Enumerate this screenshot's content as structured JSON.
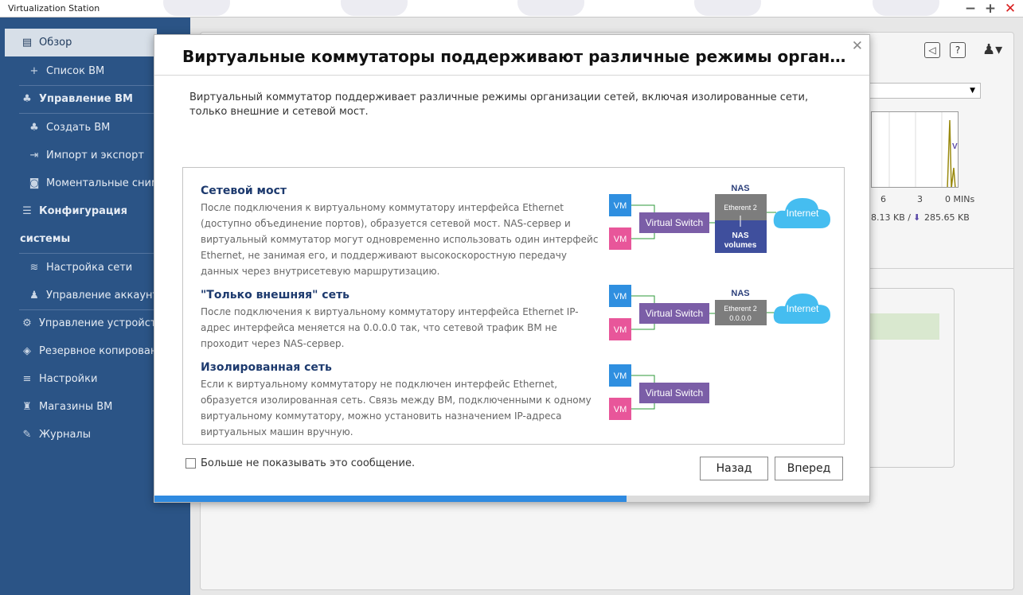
{
  "window": {
    "title": "Virtualization Station"
  },
  "sidebar": {
    "items": [
      {
        "label": "Обзор"
      },
      {
        "label": "Список ВМ"
      },
      {
        "label": "Управление ВМ"
      },
      {
        "label": "Создать ВМ"
      },
      {
        "label": "Импорт и экспорт"
      },
      {
        "label": "Моментальные сним..."
      },
      {
        "label": "Конфигурация"
      },
      {
        "label": "системы"
      },
      {
        "label": "Настройка сети"
      },
      {
        "label": "Управление аккаунт..."
      },
      {
        "label": "Управление устройств..."
      },
      {
        "label": "Резервное копирован..."
      },
      {
        "label": "Настройки"
      },
      {
        "label": "Магазины ВМ"
      },
      {
        "label": "Журналы"
      }
    ]
  },
  "main": {
    "ticks": [
      "6",
      "3",
      "0 MINs"
    ],
    "rate_up": "8.13 KB /",
    "rate_down": "285.65 KB",
    "chart_label": "V"
  },
  "modal": {
    "title": "Виртуальные коммутаторы поддерживают различные режимы организации сетей",
    "intro": "Виртуальный коммутатор поддерживает различные режимы организации сетей, включая изолированные сети, только внешние и сетевой мост.",
    "sections": [
      {
        "title": "Сетевой мост",
        "desc": "После подключения к виртуальному коммутатору интерфейса Ethernet (доступно объединение портов), образуется сетевой мост. NAS-сервер и виртуальный коммутатор могут одновременно использовать один интерфейс Ethernet, не занимая его, и поддерживают высокоскоростную передачу данных через внутрисетевую маршрутизацию."
      },
      {
        "title": "\"Только внешняя\" сеть",
        "desc": "После подключения к виртуальному коммутатору интерфейса Ethernet IP-адрес интерфейса меняется на 0.0.0.0 так, что сетевой трафик ВМ не проходит через NAS-сервер."
      },
      {
        "title": "Изолированная сеть",
        "desc": "Если к виртуальному коммутатору не подключен интерфейс Ethernet, образуется изолированная сеть. Связь между ВМ, подключенными к одному виртуальному коммутатору, можно установить назначением IP-адреса виртуальных машин вручную."
      }
    ],
    "diagram": {
      "vm": "VM",
      "switch": "Virtual Switch",
      "nas": "NAS",
      "ether": "Etherent 2",
      "ether_ip": "0.0.0.0",
      "nas_volumes_1": "NAS",
      "nas_volumes_2": "volumes",
      "internet": "Internet",
      "colors": {
        "vm_blue": "#2f8fe0",
        "vm_pink": "#e8569a",
        "switch": "#7b5ea7",
        "ether": "#7d7d7d",
        "nas_volumes": "#3f4f9d",
        "internet": "#45bdf0",
        "link": "#2e9a3a"
      }
    },
    "checkbox_label": "Больше не показывать это сообщение.",
    "back_label": "Назад",
    "next_label": "Вперед",
    "progress": 0.66
  }
}
